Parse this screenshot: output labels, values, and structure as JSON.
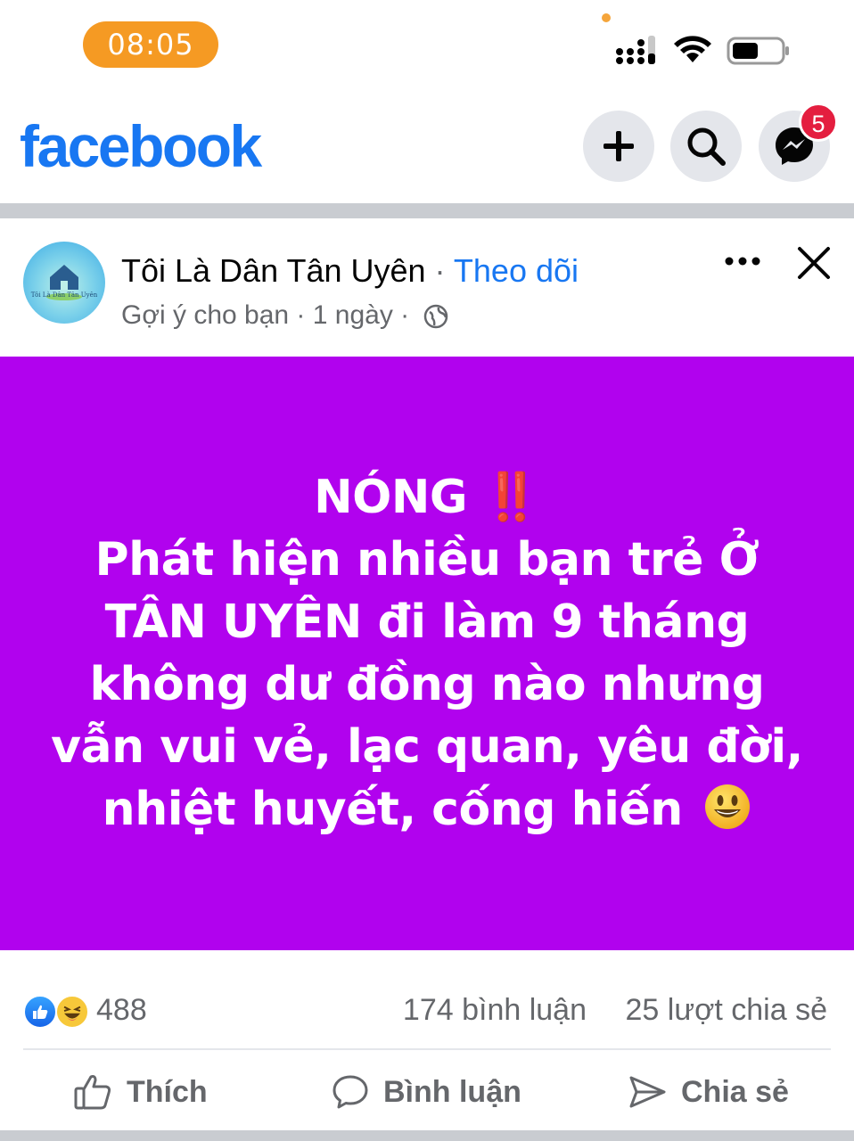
{
  "status_bar": {
    "time": "08:05",
    "accent": "#f59a23"
  },
  "header": {
    "logo": "facebook",
    "brand_color": "#1877f2",
    "buttons": [
      "plus-icon",
      "search-icon",
      "messenger-icon"
    ],
    "messenger_badge": "5"
  },
  "post": {
    "page_name": "Tôi Là Dân Tân Uyên",
    "separator": "·",
    "follow_label": "Theo dõi",
    "avatar_text": "Tôi Là Dân Tân Uyên",
    "meta": "Gợi ý cho bạn · 1 ngày ·",
    "body_bg": "#b102ee",
    "lines": {
      "l1": "NÓNG",
      "l1_bang": "‼️",
      "l2": "Phát hiện nhiều bạn trẻ Ở",
      "l3": "TÂN UYÊN đi làm 9 tháng",
      "l4": "không dư đồng nào nhưng",
      "l5": "vẫn vui vẻ, lạc quan, yêu đời,",
      "l6": "nhiệt huyết, cống hiến"
    }
  },
  "engagement": {
    "reactions_count": "488",
    "comments": "174 bình luận",
    "shares": "25 lượt chia sẻ"
  },
  "actions": {
    "like": "Thích",
    "comment": "Bình luận",
    "share": "Chia sẻ"
  }
}
